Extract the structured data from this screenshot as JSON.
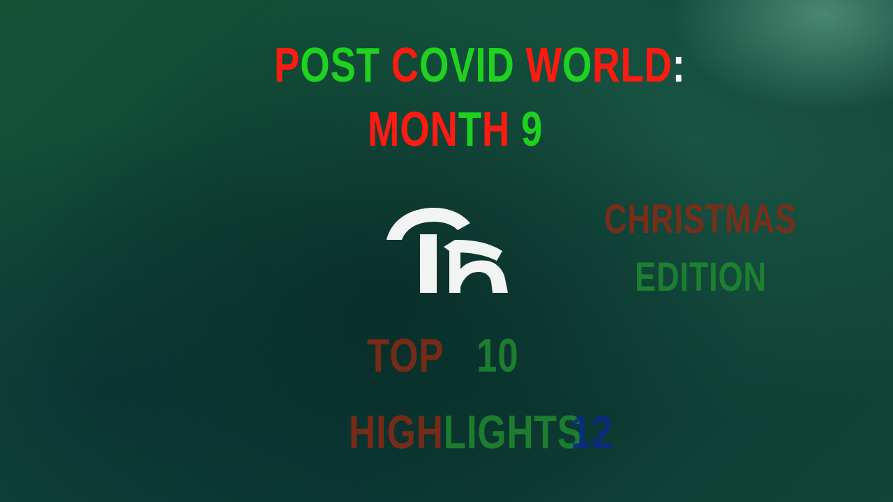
{
  "title": {
    "line1": [
      {
        "text": "P",
        "color": "red"
      },
      {
        "text": "OST ",
        "color": "green"
      },
      {
        "text": "C",
        "color": "red"
      },
      {
        "text": "OVID ",
        "color": "green"
      },
      {
        "text": "W",
        "color": "red"
      },
      {
        "text": "O",
        "color": "green"
      },
      {
        "text": "RL",
        "color": "red"
      },
      {
        "text": "D",
        "color": "red"
      },
      {
        "text": ":",
        "color": "white"
      }
    ],
    "line2": [
      {
        "text": "MO",
        "color": "red"
      },
      {
        "text": "N",
        "color": "red"
      },
      {
        "text": "T",
        "color": "green"
      },
      {
        "text": "H ",
        "color": "red"
      },
      {
        "text": "9",
        "color": "green"
      }
    ]
  },
  "logo": {
    "icon": "tx-logo-icon",
    "color": "#f2f4f3"
  },
  "edition": {
    "line1": "CHRISTMAS",
    "line2": "EDITION"
  },
  "top": {
    "label": "TOP",
    "number": "10"
  },
  "highlights": {
    "part1": "HIGH",
    "part2": "LIGHTS",
    "number": "12"
  },
  "colors": {
    "red": "#ff1b12",
    "green": "#1fd21f",
    "white": "#ffffff",
    "dark_red": "#8a2a14",
    "dark_green": "#1f8a2f",
    "blue": "#0a2a8a",
    "background": "#0f4a38"
  }
}
